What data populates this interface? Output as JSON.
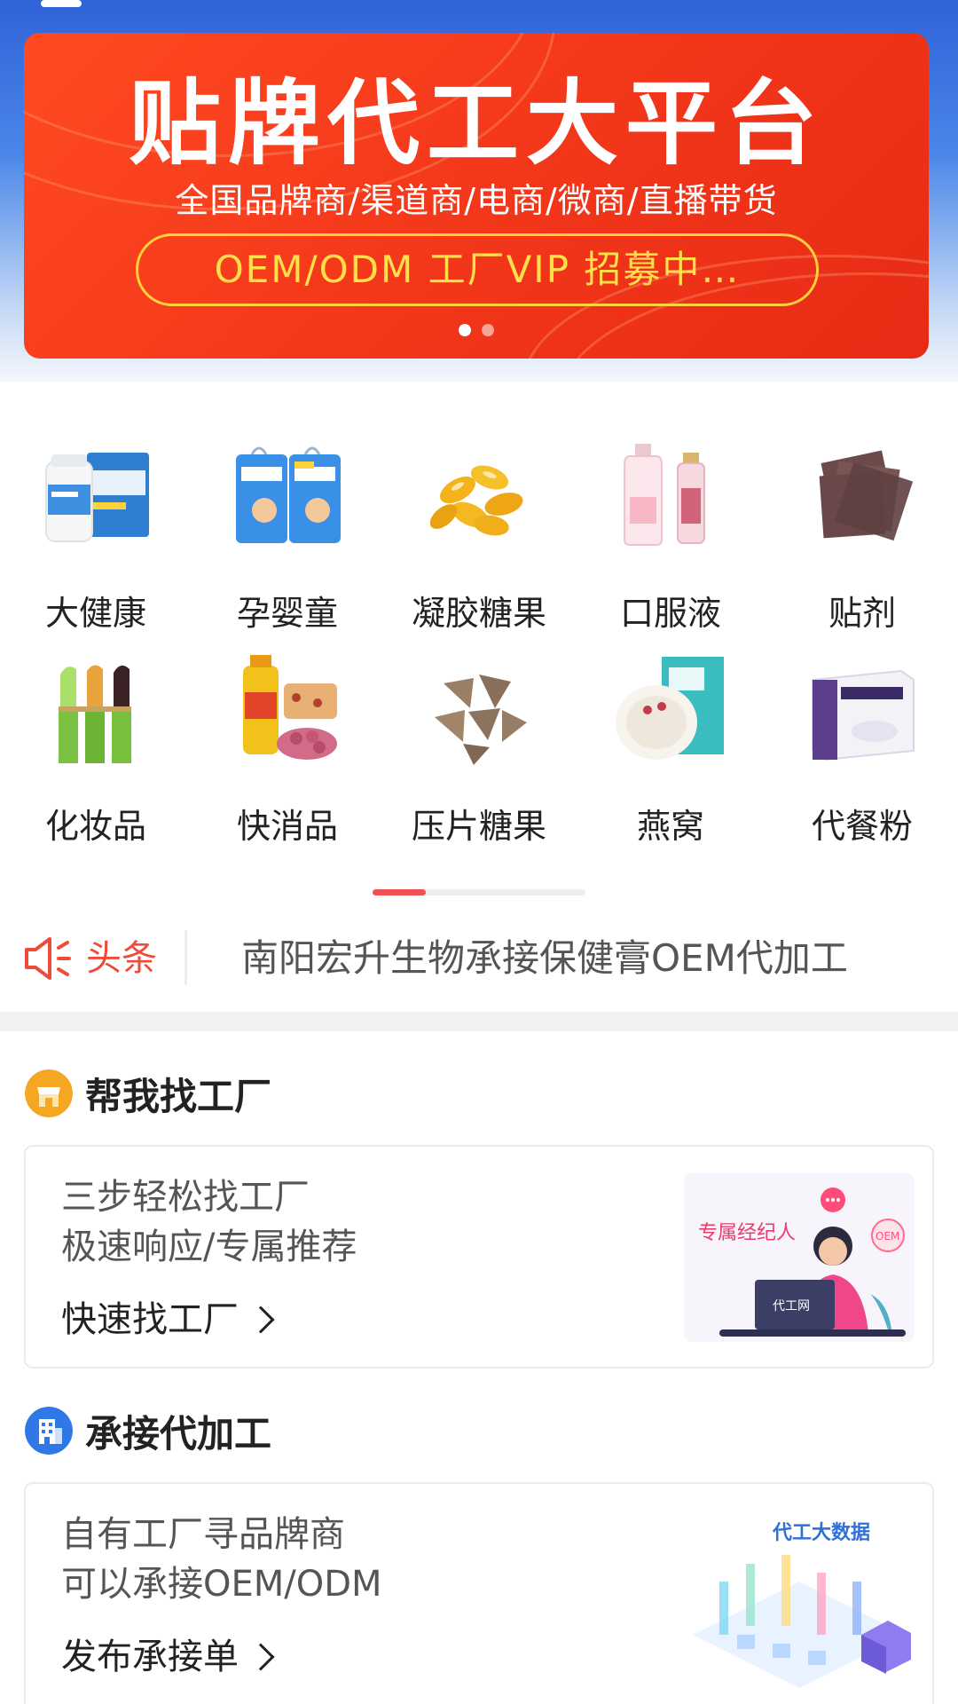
{
  "banner": {
    "title": "贴牌代工大平台",
    "subtitle": "全国品牌商/渠道商/电商/微商/直播带货",
    "pill": "OEM/ODM 工厂VIP 招募中…",
    "slides": 2,
    "active_slide": 1
  },
  "categories": [
    {
      "label": "大健康",
      "icon": "supplement-box-icon"
    },
    {
      "label": "孕婴童",
      "icon": "diaper-pack-icon"
    },
    {
      "label": "凝胶糖果",
      "icon": "softgel-capsule-icon"
    },
    {
      "label": "口服液",
      "icon": "oral-liquid-bottle-icon"
    },
    {
      "label": "贴剂",
      "icon": "patch-icon"
    },
    {
      "label": "化妆品",
      "icon": "lipstick-icon"
    },
    {
      "label": "快消品",
      "icon": "snack-oil-icon"
    },
    {
      "label": "压片糖果",
      "icon": "tablet-candy-icon"
    },
    {
      "label": "燕窝",
      "icon": "birds-nest-icon"
    },
    {
      "label": "代餐粉",
      "icon": "meal-replacement-box-icon"
    }
  ],
  "ticker": {
    "tag": "头条",
    "text": "南阳宏升生物承接保健膏OEM代加工"
  },
  "section_find": {
    "title": "帮我找工厂",
    "line1": "三步轻松找工厂",
    "line2": "极速响应/专属推荐",
    "link": "快速找工厂",
    "art_caption": "专属经纪人",
    "art_bubble": "OEM",
    "art_laptop": "代工网"
  },
  "section_take": {
    "title": "承接代加工",
    "line1": "自有工厂寻品牌商",
    "line2": "可以承接OEM/ODM",
    "link": "发布承接单",
    "art_caption": "代工大数据"
  },
  "colors": {
    "accent_red": "#ef4b3a",
    "banner_red": "#f2361a",
    "pill_yellow": "#ffd23c",
    "header_blue": "#2f63d8"
  }
}
